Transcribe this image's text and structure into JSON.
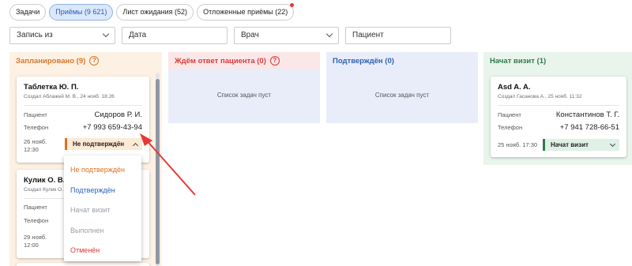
{
  "tabs": [
    {
      "label": "Задачи"
    },
    {
      "label": "Приёмы (9 621)"
    },
    {
      "label": "Лист ожидания (52)"
    },
    {
      "label": "Отложенные приёмы (22)"
    }
  ],
  "filters": [
    {
      "placeholder": "Запись из"
    },
    {
      "placeholder": "Дата"
    },
    {
      "placeholder": "Врач"
    },
    {
      "placeholder": "Пациент"
    }
  ],
  "columns": [
    {
      "title": "Запланировано (9)",
      "color": "#d9762b"
    },
    {
      "title": "Ждём ответ пациента (0)",
      "color": "#d93b3b",
      "empty_text": "Список задач пуст"
    },
    {
      "title": "Подтверждён (0)",
      "color": "#2e62b8",
      "empty_text": "Список задач пуст"
    },
    {
      "title": "Начат визит (1)",
      "color": "#2f7a4c"
    }
  ],
  "cards": {
    "c1": {
      "name": "Таблетка Ю. П.",
      "created": "Создал Аблажей М. В., 24 нояб. 18:26",
      "patient_label": "Пациент",
      "patient": "Сидоров Р. И.",
      "phone_label": "Телефон",
      "phone": "+7 993 659-43-94",
      "date": "26 нояб.",
      "time": "12:30",
      "status": "Не подтверждён"
    },
    "c2": {
      "name": "Кулик О. В.",
      "created": "Создал Кулик О.",
      "patient_label": "Пациент",
      "phone_label": "Телефон",
      "date": "29 нояб.",
      "time": "12:00"
    },
    "c3": {
      "name": "Asd A. A.",
      "created": "Создал Гасанова А., 25 нояб. 11:32",
      "patient_label": "Пациент",
      "patient": "Константинов Т. Г.",
      "phone_label": "Телефон",
      "phone": "+7 941 728-66-51",
      "datetime": "25 нояб. 17:30",
      "status": "Начат визит"
    }
  },
  "dropdown": {
    "items": [
      {
        "label": "Не подтверждён",
        "color": "#e0701c"
      },
      {
        "label": "Подтверждён",
        "color": "#2e62b8"
      },
      {
        "label": "Начат визит",
        "color": "#9aa0a8"
      },
      {
        "label": "Выполнен",
        "color": "#9aa0a8"
      },
      {
        "label": "Отменён",
        "color": "#d93b3b"
      }
    ]
  },
  "colors": {
    "planned_bg": "#fdf1e4",
    "waiting_bg": "#fbe7e7",
    "confirmed_bg": "#e8edf9",
    "started_bg": "#e8f4ec",
    "arrow": "#e53935"
  }
}
